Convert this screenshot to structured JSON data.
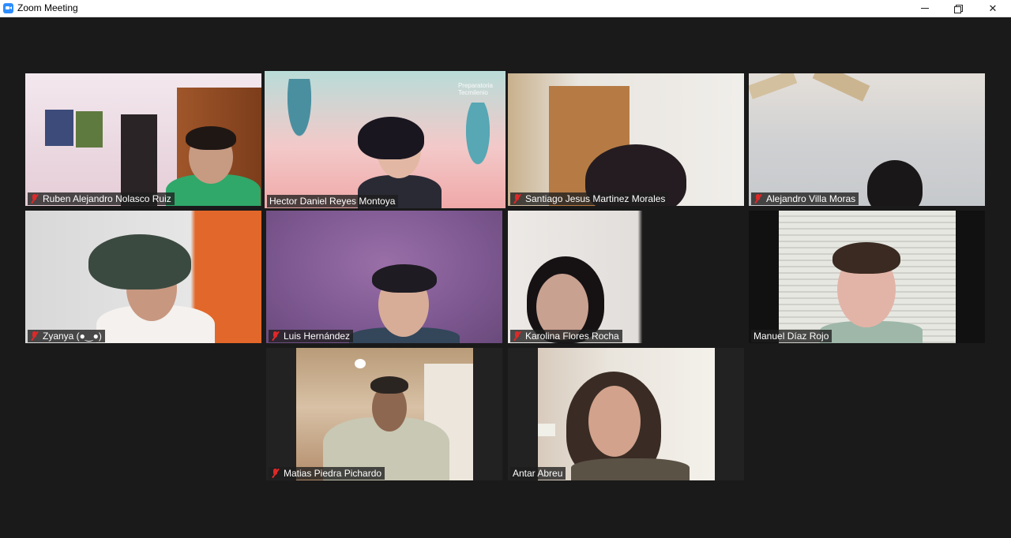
{
  "window": {
    "title": "Zoom Meeting",
    "controls": [
      "minimize",
      "restore",
      "close"
    ]
  },
  "background_color": "#1a1a1a",
  "active_speaker_color": "#e8f06b",
  "mute_color": "#e02828",
  "participants": [
    {
      "name": "Ruben Alejandro Nolasco Ruiz",
      "muted": true,
      "active": false
    },
    {
      "name": "Hector Daniel Reyes Montoya",
      "muted": false,
      "active": true,
      "background_brand": "Preparatoria Tecmilenio"
    },
    {
      "name": "Santiago Jesus Martinez Morales",
      "muted": true,
      "active": false
    },
    {
      "name": "Alejandro Villa Moras",
      "muted": true,
      "active": false
    },
    {
      "name": "Zyanya (●‿●)",
      "muted": true,
      "active": false
    },
    {
      "name": "Luis Hernández",
      "muted": true,
      "active": false
    },
    {
      "name": "Karolina Flores Rocha",
      "muted": true,
      "active": false
    },
    {
      "name": "Manuel Díaz Rojo",
      "muted": false,
      "active": false
    },
    {
      "name": "Matias Piedra Pichardo",
      "muted": true,
      "active": false
    },
    {
      "name": "Antar Abreu",
      "muted": false,
      "active": false
    }
  ]
}
